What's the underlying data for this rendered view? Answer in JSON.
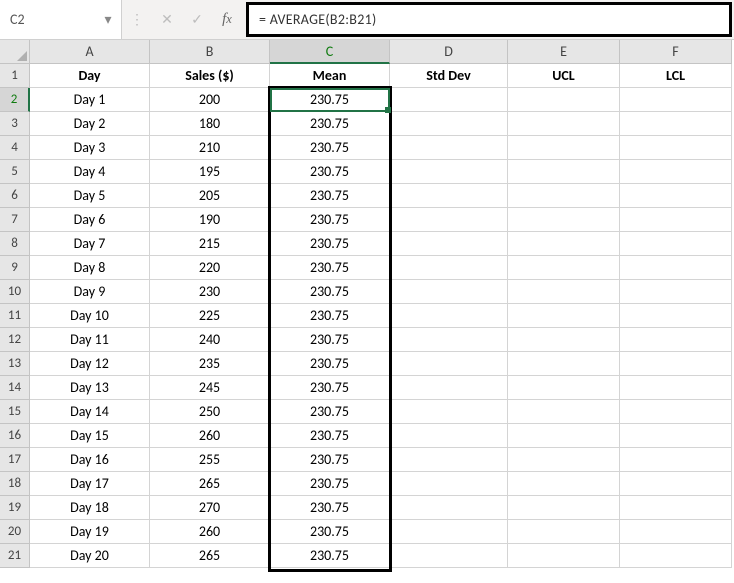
{
  "namebox": {
    "ref": "C2"
  },
  "formula_bar": {
    "text": "= AVERAGE(B2:B21)"
  },
  "columns": [
    "A",
    "B",
    "C",
    "D",
    "E",
    "F"
  ],
  "active_col_index": 2,
  "active_row_number": 2,
  "headers": {
    "A": "Day",
    "B": "Sales ($)",
    "C": "Mean",
    "D": "Std Dev",
    "E": "UCL",
    "F": "LCL"
  },
  "rows": [
    {
      "n": 1
    },
    {
      "n": 2,
      "day": "Day 1",
      "sales": "200",
      "mean": "230.75"
    },
    {
      "n": 3,
      "day": "Day 2",
      "sales": "180",
      "mean": "230.75"
    },
    {
      "n": 4,
      "day": "Day 3",
      "sales": "210",
      "mean": "230.75"
    },
    {
      "n": 5,
      "day": "Day 4",
      "sales": "195",
      "mean": "230.75"
    },
    {
      "n": 6,
      "day": "Day 5",
      "sales": "205",
      "mean": "230.75"
    },
    {
      "n": 7,
      "day": "Day 6",
      "sales": "190",
      "mean": "230.75"
    },
    {
      "n": 8,
      "day": "Day 7",
      "sales": "215",
      "mean": "230.75"
    },
    {
      "n": 9,
      "day": "Day 8",
      "sales": "220",
      "mean": "230.75"
    },
    {
      "n": 10,
      "day": "Day 9",
      "sales": "230",
      "mean": "230.75"
    },
    {
      "n": 11,
      "day": "Day 10",
      "sales": "225",
      "mean": "230.75"
    },
    {
      "n": 12,
      "day": "Day 11",
      "sales": "240",
      "mean": "230.75"
    },
    {
      "n": 13,
      "day": "Day 12",
      "sales": "235",
      "mean": "230.75"
    },
    {
      "n": 14,
      "day": "Day 13",
      "sales": "245",
      "mean": "230.75"
    },
    {
      "n": 15,
      "day": "Day 14",
      "sales": "250",
      "mean": "230.75"
    },
    {
      "n": 16,
      "day": "Day 15",
      "sales": "260",
      "mean": "230.75"
    },
    {
      "n": 17,
      "day": "Day 16",
      "sales": "255",
      "mean": "230.75"
    },
    {
      "n": 18,
      "day": "Day 17",
      "sales": "265",
      "mean": "230.75"
    },
    {
      "n": 19,
      "day": "Day 18",
      "sales": "270",
      "mean": "230.75"
    },
    {
      "n": 20,
      "day": "Day 19",
      "sales": "260",
      "mean": "230.75"
    },
    {
      "n": 21,
      "day": "Day 20",
      "sales": "265",
      "mean": "230.75"
    }
  ],
  "icons": {
    "caret_down": "▾",
    "insert_fn_colon": "⋮",
    "cancel": "✕",
    "enter": "✓"
  }
}
